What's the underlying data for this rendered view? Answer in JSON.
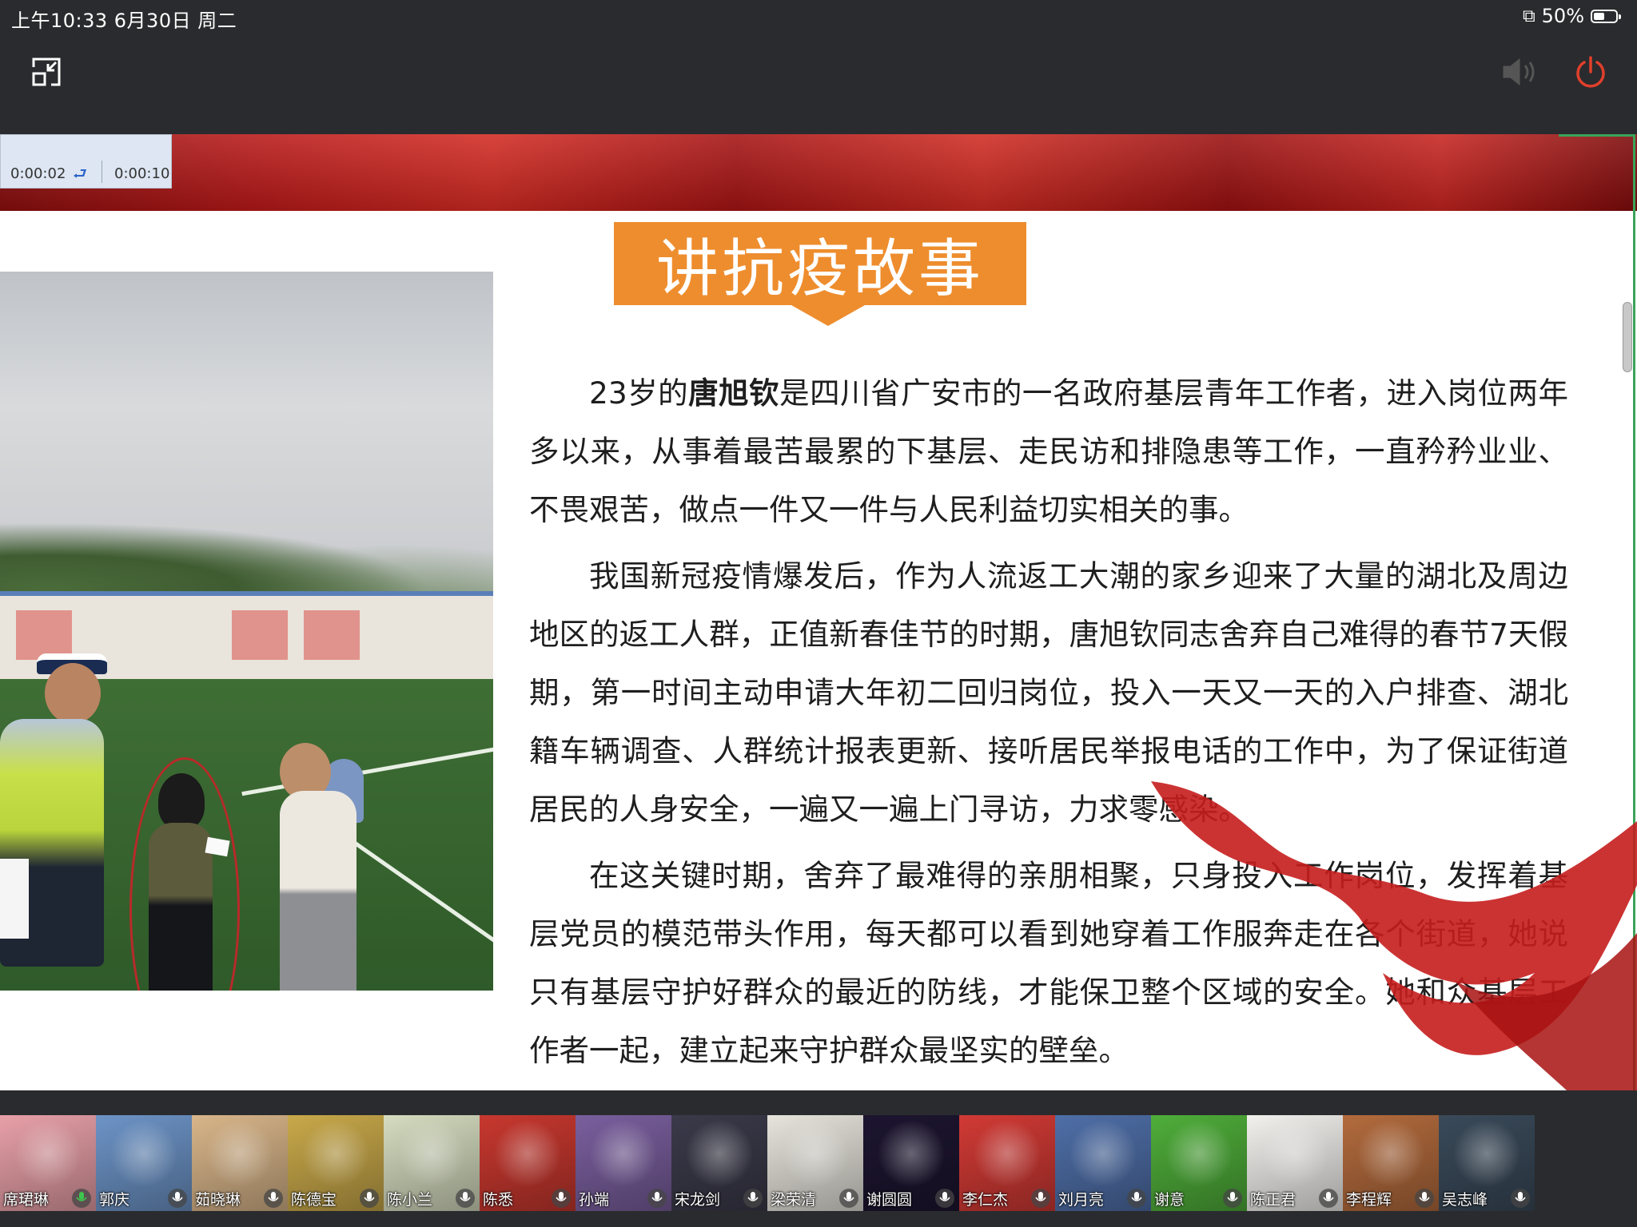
{
  "status_bar": {
    "time_date": "上午10:33   6月30日 周二",
    "battery_text": "50%",
    "battery_level": 0.5
  },
  "toolbar": {
    "icons": [
      "exit-fullscreen-icon",
      "speaker-icon",
      "power-icon"
    ],
    "accent_power": "#e0402c"
  },
  "slide": {
    "timer": {
      "elapsed": "0:00:02",
      "total": "0:00:10"
    },
    "title": "讲抗疫故事",
    "title_color": "#ee8d2e",
    "paragraphs": [
      {
        "lead": "23岁的",
        "name": "唐旭钦",
        "rest": "是四川省广安市的一名政府基层青年工作者，进入岗位两年多以来，从事着最苦最累的下基层、走民访和排隐患等工作，一直矜矜业业、不畏艰苦，做点一件又一件与人民利益切实相关的事。"
      },
      {
        "text": "我国新冠疫情爆发后，作为人流返工大潮的家乡迎来了大量的湖北及周边地区的返工人群，正值新春佳节的时期，唐旭钦同志舍弃自己难得的春节7天假期，第一时间主动申请大年初二回归岗位，投入一天又一天的入户排查、湖北籍车辆调查、人群统计报表更新、接听居民举报电话的工作中，为了保证街道居民的人身安全，一遍又一遍上门寻访，力求零感染。"
      },
      {
        "text": "在这关键时期，舍弃了最难得的亲朋相聚，只身投入工作岗位，发挥着基层党员的模范带头作用，每天都可以看到她穿着工作服奔走在各个街道，她说只有基层守护好群众的最近的防线，才能保卫整个区域的安全。她和众基层工作者一起，建立起来守护群众最坚实的壁垒。"
      }
    ]
  },
  "participants": [
    {
      "name": "席珺琳",
      "color": "#e8a0a8"
    },
    {
      "name": "郭庆",
      "color": "#6d94c7"
    },
    {
      "name": "茹晓琳",
      "color": "#d9b68a"
    },
    {
      "name": "陈德宝",
      "color": "#c9a94a"
    },
    {
      "name": "陈小兰",
      "color": "#d6dcc0"
    },
    {
      "name": "陈悉",
      "color": "#c8382f"
    },
    {
      "name": "孙端",
      "color": "#7a5f9e"
    },
    {
      "name": "宋龙剑",
      "color": "#3b3a4a"
    },
    {
      "name": "梁荣清",
      "color": "#e7e4dc"
    },
    {
      "name": "谢圆圆",
      "color": "#1d1530"
    },
    {
      "name": "李仁杰",
      "color": "#d23a35"
    },
    {
      "name": "刘月亮",
      "color": "#4f6fa8"
    },
    {
      "name": "谢意",
      "color": "#4fae3a"
    },
    {
      "name": "陈正君",
      "color": "#f2f1ee"
    },
    {
      "name": "李程辉",
      "color": "#b36b3d"
    },
    {
      "name": "吴志峰",
      "color": "#3a4a5a"
    }
  ]
}
